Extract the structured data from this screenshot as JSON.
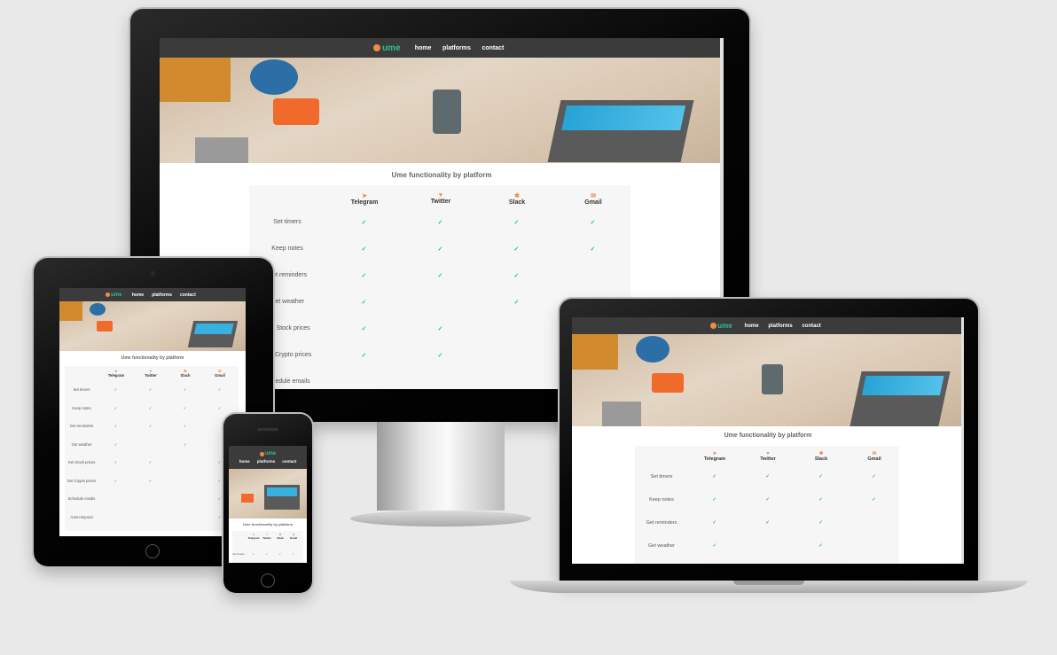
{
  "site": {
    "logo_text": "ume",
    "nav": [
      "home",
      "platforms",
      "contact"
    ],
    "title": "Ume functionality by platform",
    "platforms": [
      {
        "name": "Telegram",
        "icon": "telegram-icon",
        "glyph": "➤"
      },
      {
        "name": "Twitter",
        "icon": "twitter-icon",
        "glyph": "♥"
      },
      {
        "name": "Slack",
        "icon": "slack-icon",
        "glyph": "✱"
      },
      {
        "name": "Gmail",
        "icon": "gmail-icon",
        "glyph": "✉"
      }
    ],
    "features": [
      {
        "name": "Set timers",
        "support": [
          true,
          true,
          true,
          true
        ]
      },
      {
        "name": "Keep notes",
        "support": [
          true,
          true,
          true,
          true
        ]
      },
      {
        "name": "Get reminders",
        "support": [
          true,
          true,
          true,
          false
        ]
      },
      {
        "name": "Get weather",
        "support": [
          true,
          false,
          true,
          false
        ]
      },
      {
        "name": "Get Stock prices",
        "support": [
          true,
          true,
          false,
          true
        ]
      },
      {
        "name": "Get Crypto prices",
        "support": [
          true,
          true,
          false,
          true
        ]
      },
      {
        "name": "Schedule emails",
        "support": [
          false,
          false,
          false,
          true
        ]
      },
      {
        "name": "Auto-respond",
        "support": [
          false,
          false,
          false,
          true
        ]
      }
    ],
    "monitor_features": [
      {
        "name": "Set timers",
        "support": [
          true,
          true,
          true,
          true
        ]
      },
      {
        "name": "Keep notes",
        "support": [
          true,
          true,
          true,
          true
        ]
      },
      {
        "name": "Get reminders",
        "support": [
          true,
          true,
          true,
          false
        ]
      },
      {
        "name": "Get weather",
        "support": [
          true,
          false,
          true,
          false
        ]
      },
      {
        "name": "Get Stock prices",
        "support": [
          true,
          true,
          false,
          false
        ]
      },
      {
        "name": "Get Crypto prices",
        "support": [
          true,
          true,
          false,
          false
        ]
      },
      {
        "name": "Schedule emails",
        "support": [
          false,
          false,
          false,
          false
        ]
      }
    ],
    "monitor_platform_labels": [
      "Telegram",
      "Twitter",
      "Slack",
      "Gmail"
    ],
    "check_glyph": "✓"
  },
  "colors": {
    "accent": "#f28b4a",
    "logo": "#2dc08f",
    "check": "#2dc08f",
    "nav_bg": "#3b3b3b",
    "background": "#e9e9e9"
  }
}
